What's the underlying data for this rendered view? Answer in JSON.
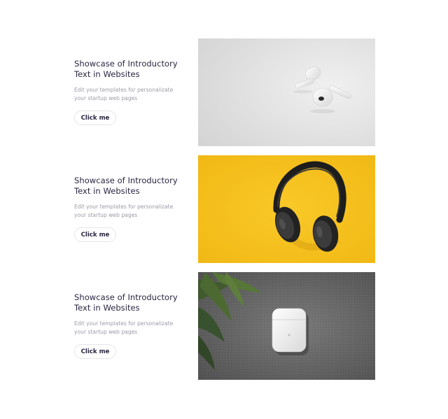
{
  "items": [
    {
      "title": "Showcase of Introductory Text in Websites",
      "description": "Edit your templates for personalizate your startup web pages",
      "button_label": "Click me",
      "image": "earbuds-image"
    },
    {
      "title": "Showcase of Introductory Text in Websites",
      "description": "Edit your templates for personalizate your startup web pages",
      "button_label": "Click me",
      "image": "headphones-image"
    },
    {
      "title": "Showcase of Introductory Text in Websites",
      "description": "Edit your templates for personalizate your startup web pages",
      "button_label": "Click me",
      "image": "earbuds-case-image"
    }
  ],
  "colors": {
    "title": "#2a2540",
    "description": "#9a9aa6",
    "button_border": "#e6e4ea",
    "yellow_background": "#f6c21c",
    "gray_background": "#e4e4e4",
    "carpet_background": "#5f5f5f"
  }
}
